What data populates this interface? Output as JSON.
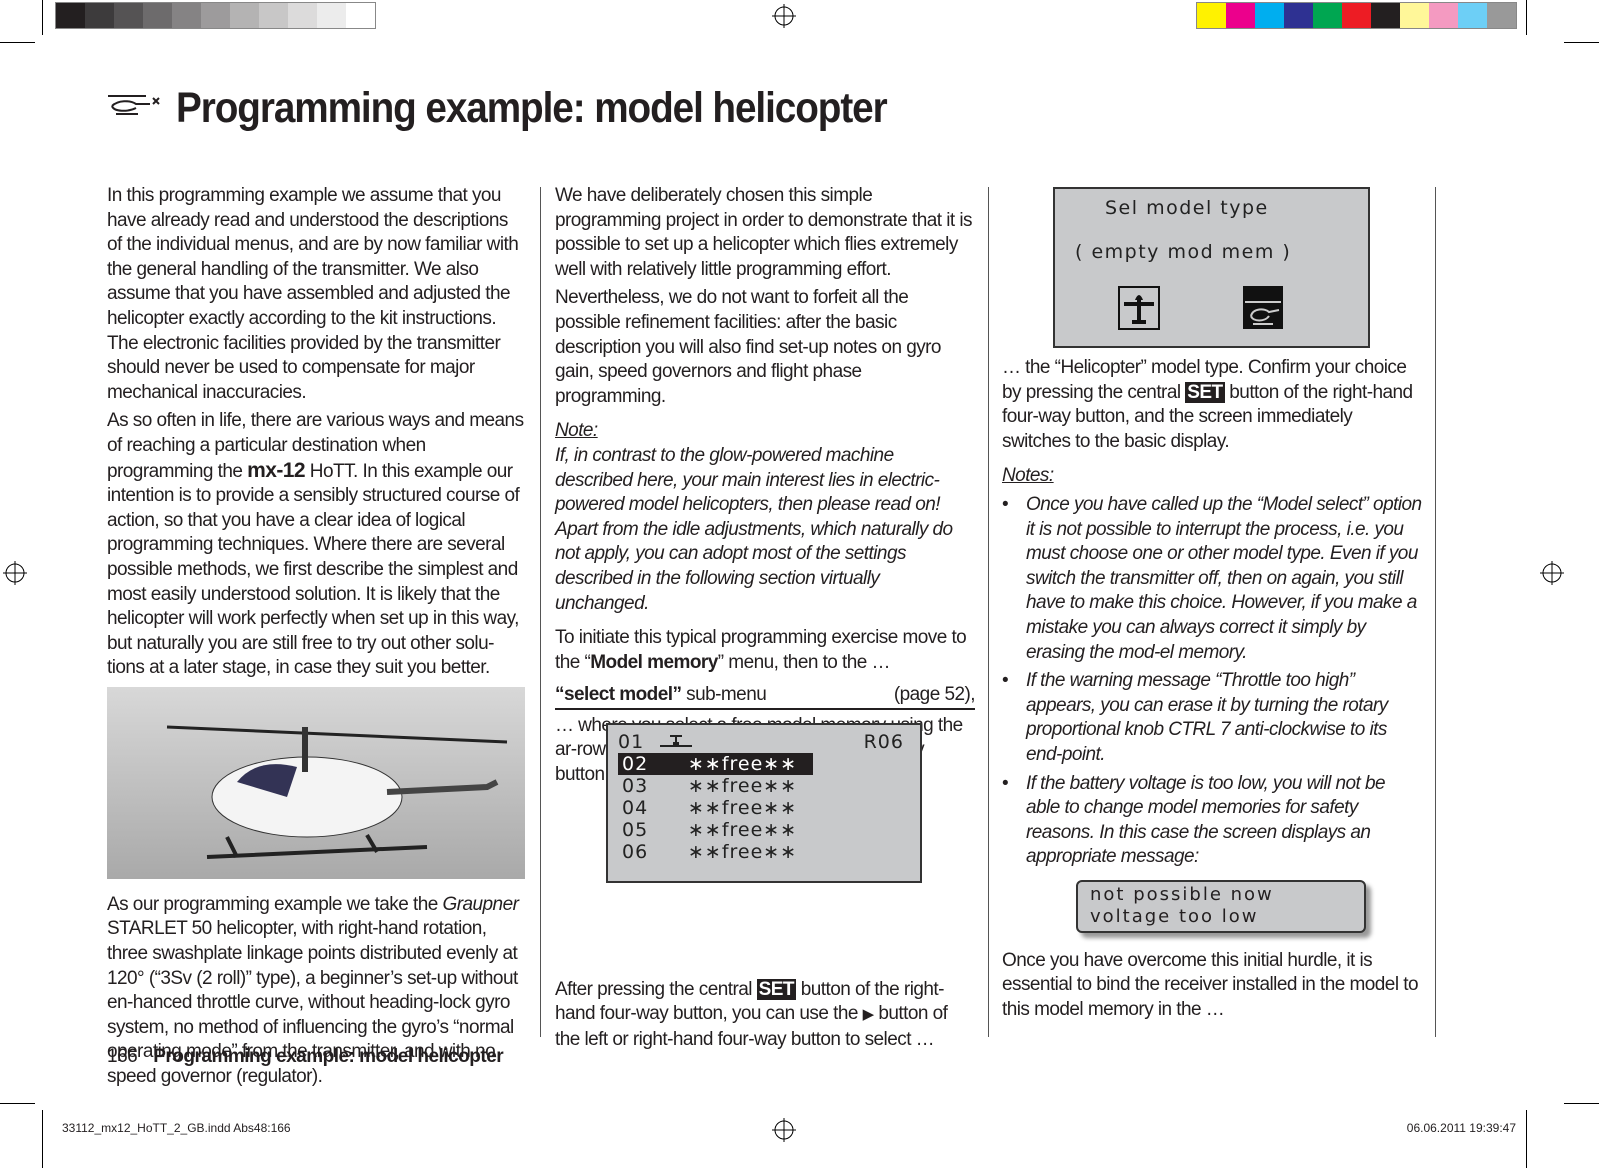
{
  "page": {
    "title": "Programming example: model helicopter",
    "number": "166",
    "footer_title": "Programming example: model helicopter",
    "slug_left": "33112_mx12_HoTT_2_GB.indd   Abs48:166",
    "slug_right": "06.06.2011   19:39:47"
  },
  "colorbar_gray": [
    "#231f20",
    "#3d3b3c",
    "#555354",
    "#6d6b6c",
    "#858384",
    "#9d9b9c",
    "#b4b3b3",
    "#c8c7c7",
    "#dcdbdb",
    "#ececec",
    "#ffffff"
  ],
  "colorbar_color": [
    "#fff200",
    "#ec008c",
    "#00aeef",
    "#2e3192",
    "#00a651",
    "#ed1c24",
    "#231f20",
    "#fff799",
    "#f49ac1",
    "#6dcff6",
    "#999999"
  ],
  "col1": {
    "p1": "In this programming example we assume that you have already read and understood the descriptions of the individual menus, and are by now familiar with the general handling of the transmitter. We also assume that you have assembled and adjusted the helicopter exactly according to the kit instructions. The electronic facilities provided by the transmitter should never be used to compensate for major mechanical inaccuracies.",
    "p2a": "As so often in life, there are various ways and means of reaching a particular destination when programming the ",
    "p2_brand": "mx-12",
    "p2b": " HoTT. In this example our intention is to provide a sensibly structured course of action, so that you have a clear idea of logical programming techniques. Where there are several possible methods, we first describe the simplest and most easily understood solution. It is likely that the helicopter will work perfectly when set up in this way, but naturally you are still free to try out other solu-tions at a later stage, in case they suit you better.",
    "p3a": "As our programming example we take the ",
    "p3_italic": "Graupner",
    "p3b": " STARLET 50 helicopter, with right-hand rotation, three swashplate linkage points distributed evenly at 120° (“3Sv (2 roll)” type), a beginner’s set-up without en-hanced throttle curve, without heading-lock gyro system, no method of influencing the gyro’s “normal operating mode” from the transmitter, and with no speed governor (regulator)."
  },
  "col2": {
    "p1": "We have deliberately chosen this simple programming project in order to demonstrate that it is possible to set up a helicopter which flies extremely well with relatively little programming effort.",
    "p2": "Nevertheless, we do not want to forfeit all the possible refinement facilities: after the basic description you will also find set-up notes on gyro gain, speed governors and flight phase programming.",
    "note_label": "Note:",
    "note": "If, in contrast to the glow-powered machine described here, your main interest lies in electric-powered model helicopters, then please read on! Apart from the idle adjustments, which naturally do not apply, you can adopt most of the settings described in the following section virtually unchanged.",
    "p3a": "To initiate this typical programming exercise move to the “",
    "p3_bold": "Model memory",
    "p3b": "” menu, then to the …",
    "submenu_bold": "“select model”",
    "submenu": " sub-menu",
    "submenu_page": "(page 52),",
    "p4": "… where you select a free model memory using the ar-row buttons of the left or right-hand four-way button:",
    "p5a": "After pressing the central ",
    "set": "SET",
    "p5b": " button of the right-hand four-way button, you can use the ",
    "arrow": "▶",
    "p5c": " button of the left or right-hand four-way button to select …"
  },
  "lcd_list": {
    "header_num": "01",
    "header_right": "R06",
    "rows": [
      {
        "num": "02",
        "val": "∗∗free∗∗",
        "selected": true
      },
      {
        "num": "03",
        "val": "∗∗free∗∗"
      },
      {
        "num": "04",
        "val": "∗∗free∗∗"
      },
      {
        "num": "05",
        "val": "∗∗free∗∗"
      },
      {
        "num": "06",
        "val": "∗∗free∗∗"
      }
    ]
  },
  "lcd_type": {
    "line1": "Sel  model  type",
    "line2": "( empty  mod  mem )",
    "icons": [
      "airplane-icon",
      "helicopter-icon"
    ],
    "selected": "helicopter-icon"
  },
  "col3": {
    "p1a": "… the “Helicopter” model type. Confirm your choice by pressing the central ",
    "set": "SET",
    "p1b": " button of the right-hand four-way button, and the screen immediately switches to the basic display.",
    "notes_label": "Notes:",
    "notes": [
      "Once you have called up the “Model select” option it is not possible to interrupt the process, i.e. you must choose one or other model type. Even if you switch the transmitter off, then on again, you still have to make this choice. However, if you make a mistake you can always correct it simply by erasing the mod-el memory.",
      "If the warning message “Throttle too high” appears, you can erase it by turning the rotary proportional knob CTRL 7 anti-clockwise to its end-point.",
      "If the battery voltage is too low, you will not be able to change model memories for safety reasons. In this case the screen displays an appropriate message:"
    ],
    "msg1": "not  possible  now",
    "msg2": "voltage  too  low",
    "p2": "Once you have overcome this initial hurdle, it is essential to bind the receiver installed in the model to this model memory in the …"
  }
}
